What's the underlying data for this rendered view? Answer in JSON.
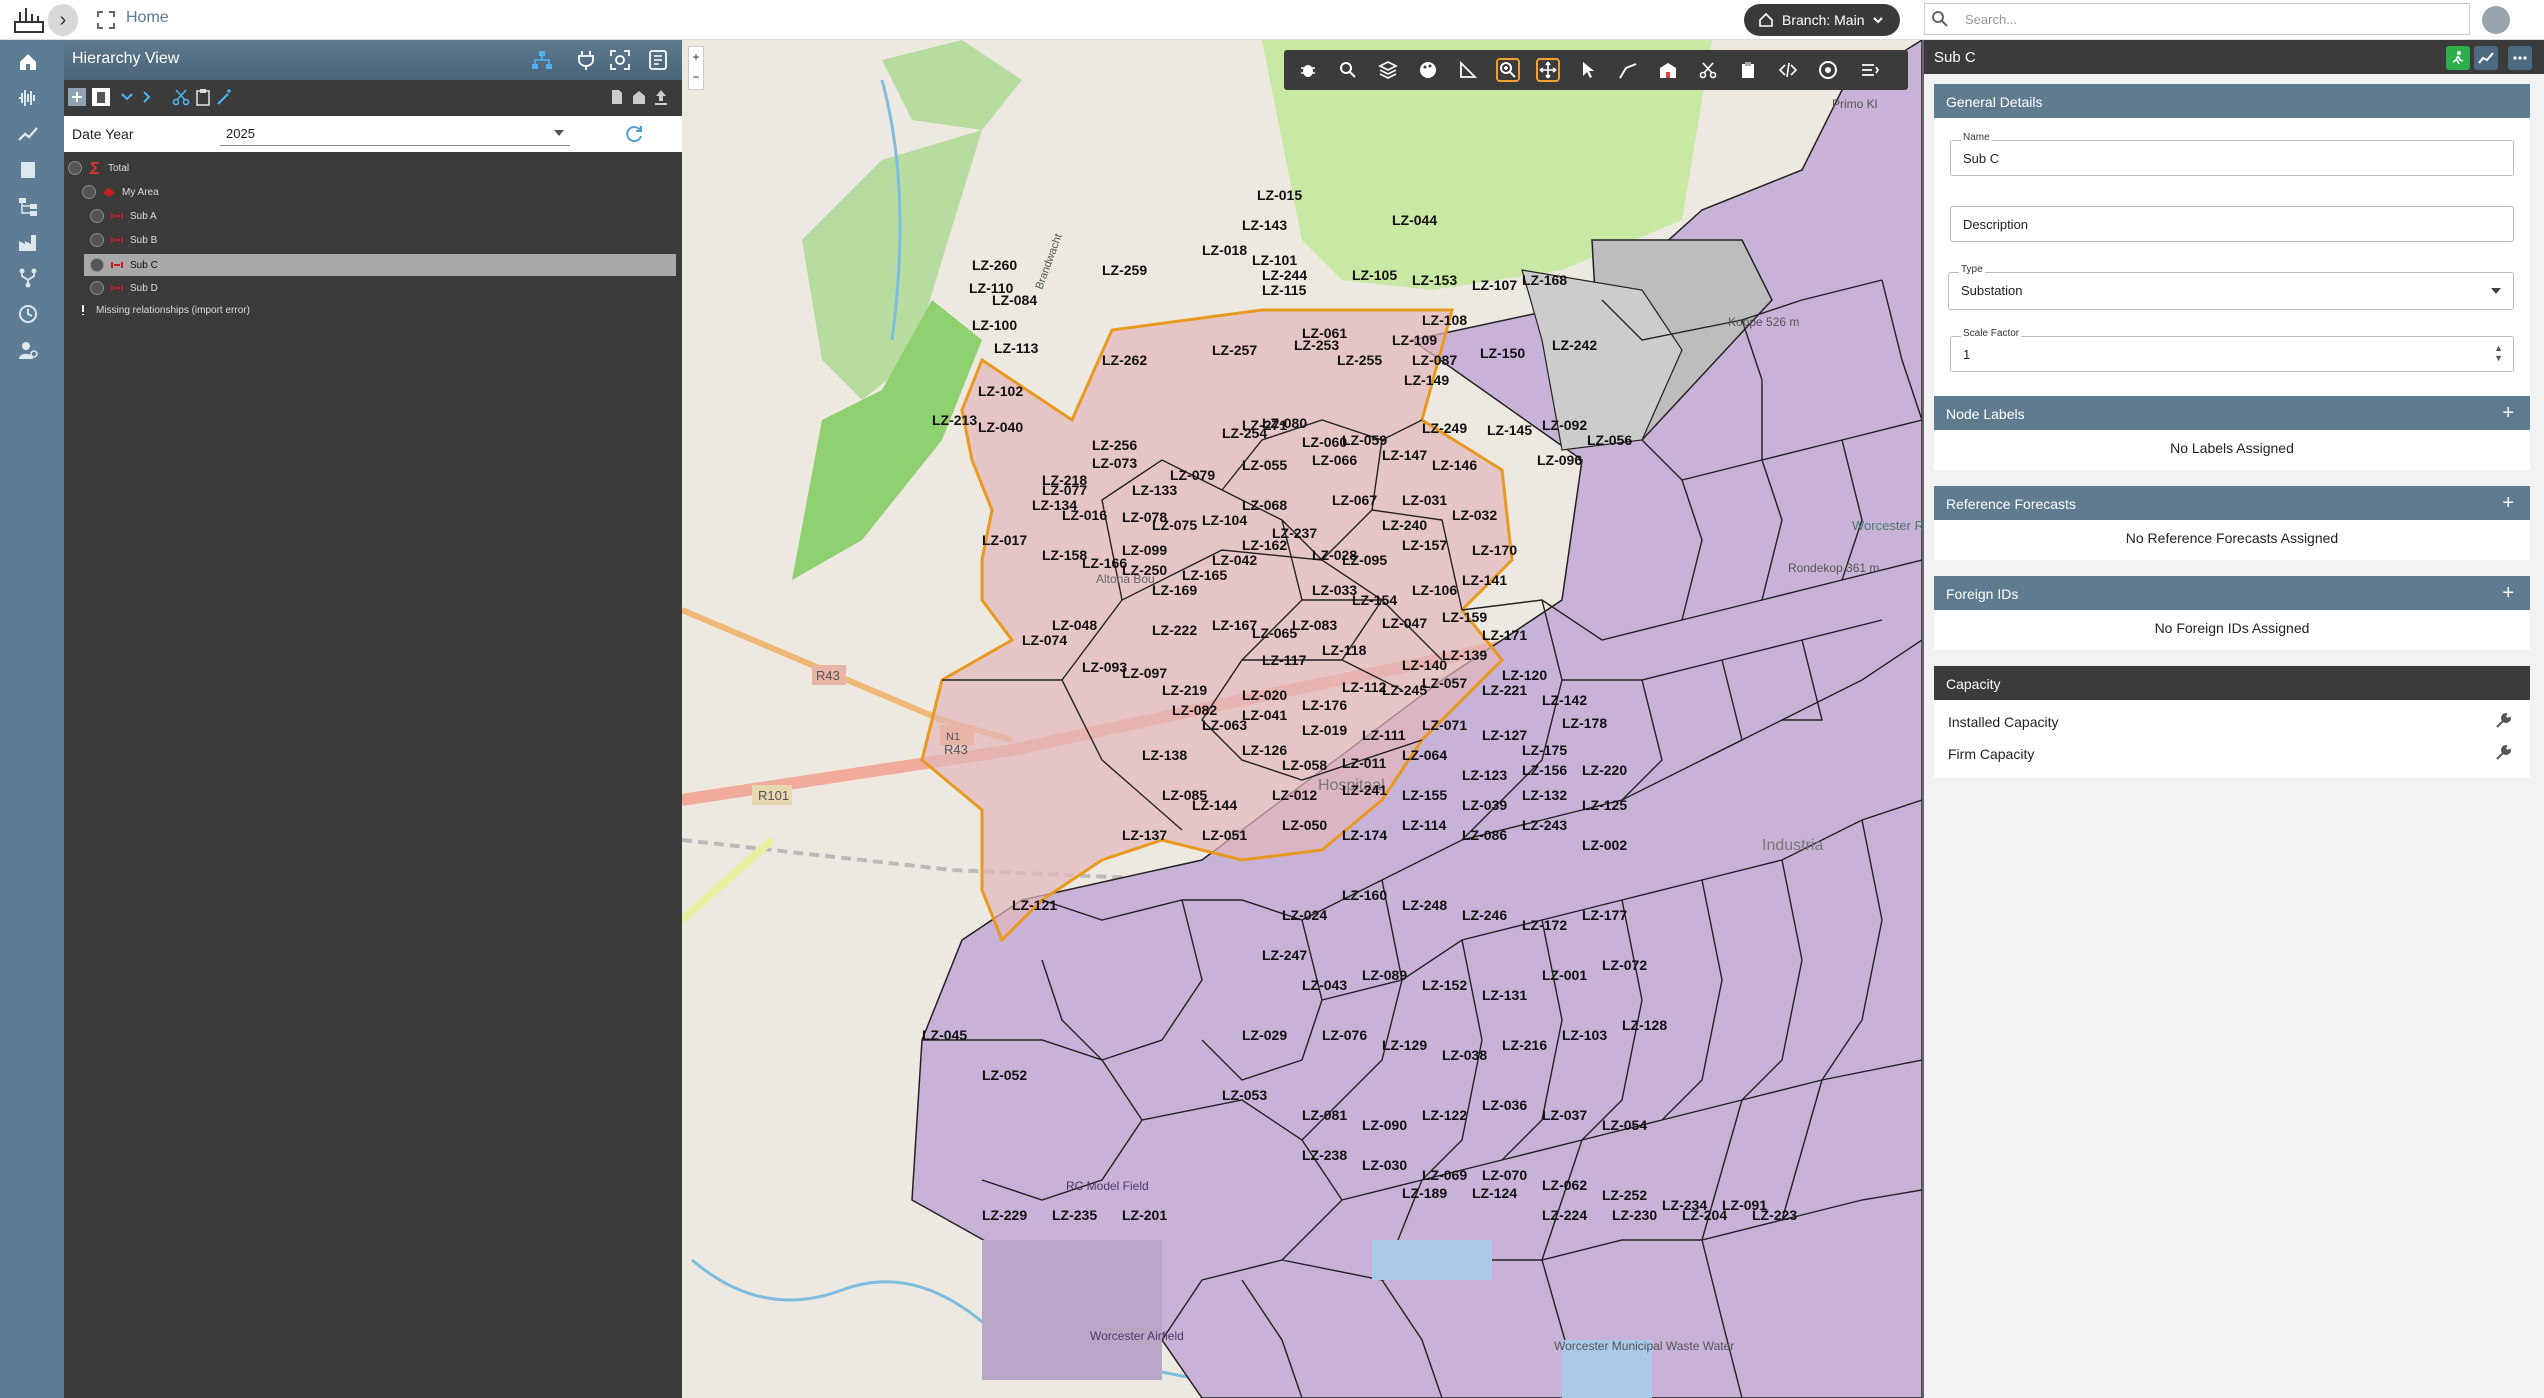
{
  "topbar": {
    "home": "Home",
    "branch": "Branch: Main",
    "search_placeholder": "Search..."
  },
  "nav": {
    "icons": [
      "home-icon",
      "waveform-icon",
      "trend-icon",
      "book-icon",
      "hierarchy-icon",
      "factory-icon",
      "branch-icon",
      "history-icon",
      "user-settings-icon"
    ]
  },
  "hierarchy": {
    "title": "Hierarchy View",
    "date_label": "Date Year",
    "date_value": "2025",
    "tree": [
      {
        "label": "Total",
        "level": 0
      },
      {
        "label": "My Area",
        "level": 1
      },
      {
        "label": "Sub A",
        "level": 2
      },
      {
        "label": "Sub B",
        "level": 2
      },
      {
        "label": "Sub C",
        "level": 2,
        "selected": true
      },
      {
        "label": "Sub D",
        "level": 2
      },
      {
        "label": "Missing relationships (import error)",
        "level": 0
      }
    ]
  },
  "map": {
    "road_labels": [
      "R43",
      "R43",
      "R101",
      "N1"
    ],
    "place_labels": [
      "Altona Bou",
      "Rondekop 361 m",
      "Worcester Reserv",
      "Koppe 526 m",
      "Brandwacht",
      "Primo Kl",
      "RC Model Field",
      "Worcester Airfield",
      "Worcester Municipal Waste Water",
      "Industria",
      "Hospitaal"
    ],
    "zones": [
      "LZ-015",
      "LZ-044",
      "LZ-018",
      "LZ-143",
      "LZ-101",
      "LZ-244",
      "LZ-115",
      "LZ-105",
      "LZ-153",
      "LZ-107",
      "LZ-168",
      "LZ-259",
      "LZ-260",
      "LZ-110",
      "LZ-084",
      "LZ-100",
      "LZ-113",
      "LZ-262",
      "LZ-257",
      "LZ-253",
      "LZ-255",
      "LZ-061",
      "LZ-109",
      "LZ-108",
      "LZ-087",
      "LZ-149",
      "LZ-150",
      "LZ-242",
      "LZ-102",
      "LZ-213",
      "LZ-040",
      "LZ-254",
      "LZ-256",
      "LZ-271",
      "LZ-080",
      "LZ-060",
      "LZ-059",
      "LZ-249",
      "LZ-145",
      "LZ-092",
      "LZ-056",
      "LZ-096",
      "LZ-218",
      "LZ-073",
      "LZ-079",
      "LZ-077",
      "LZ-134",
      "LZ-133",
      "LZ-055",
      "LZ-066",
      "LZ-147",
      "LZ-146",
      "LZ-016",
      "LZ-078",
      "LZ-075",
      "LZ-068",
      "LZ-067",
      "LZ-031",
      "LZ-017",
      "LZ-099",
      "LZ-104",
      "LZ-237",
      "LZ-162",
      "LZ-240",
      "LZ-032",
      "LZ-158",
      "LZ-166",
      "LZ-250",
      "LZ-042",
      "LZ-028",
      "LZ-095",
      "LZ-157",
      "LZ-170",
      "LZ-169",
      "LZ-165",
      "LZ-033",
      "LZ-154",
      "LZ-106",
      "LZ-141",
      "LZ-074",
      "LZ-048",
      "LZ-222",
      "LZ-167",
      "LZ-065",
      "LZ-083",
      "LZ-047",
      "LZ-159",
      "LZ-171",
      "LZ-093",
      "LZ-097",
      "LZ-117",
      "LZ-118",
      "LZ-140",
      "LZ-139",
      "LZ-120",
      "LZ-219",
      "LZ-176",
      "LZ-020",
      "LZ-112",
      "LZ-245",
      "LZ-057",
      "LZ-221",
      "LZ-142",
      "LZ-082",
      "LZ-041",
      "LZ-063",
      "LZ-019",
      "LZ-111",
      "LZ-071",
      "LZ-127",
      "LZ-175",
      "LZ-178",
      "LZ-138",
      "LZ-126",
      "LZ-058",
      "LZ-011",
      "LZ-064",
      "LZ-123",
      "LZ-156",
      "LZ-220",
      "LZ-085",
      "LZ-144",
      "LZ-012",
      "LZ-241",
      "LZ-155",
      "LZ-039",
      "LZ-132",
      "LZ-125",
      "LZ-137",
      "LZ-051",
      "LZ-050",
      "LZ-174",
      "LZ-114",
      "LZ-086",
      "LZ-243",
      "LZ-002",
      "LZ-121",
      "LZ-024",
      "LZ-160",
      "LZ-248",
      "LZ-246",
      "LZ-172",
      "LZ-177",
      "LZ-045",
      "LZ-247",
      "LZ-043",
      "LZ-089",
      "LZ-152",
      "LZ-131",
      "LZ-001",
      "LZ-072",
      "LZ-052",
      "LZ-029",
      "LZ-076",
      "LZ-129",
      "LZ-038",
      "LZ-216",
      "LZ-103",
      "LZ-128",
      "LZ-053",
      "LZ-081",
      "LZ-090",
      "LZ-122",
      "LZ-036",
      "LZ-037",
      "LZ-054",
      "LZ-238",
      "LZ-030",
      "LZ-069",
      "LZ-070",
      "LZ-062",
      "LZ-252",
      "LZ-234",
      "LZ-091",
      "LZ-189",
      "LZ-124",
      "LZ-224",
      "LZ-230",
      "LZ-204",
      "LZ-223",
      "LZ-229",
      "LZ-235",
      "LZ-201"
    ]
  },
  "panel": {
    "title": "Sub C",
    "general": {
      "heading": "General Details",
      "name_label": "Name",
      "name_value": "Sub C",
      "description_placeholder": "Description",
      "type_label": "Type",
      "type_value": "Substation",
      "scale_label": "Scale Factor",
      "scale_value": "1"
    },
    "node_labels": {
      "heading": "Node Labels",
      "empty": "No Labels Assigned"
    },
    "ref_forecasts": {
      "heading": "Reference Forecasts",
      "empty": "No Reference Forecasts Assigned"
    },
    "foreign_ids": {
      "heading": "Foreign IDs",
      "empty": "No Foreign IDs Assigned"
    },
    "capacity": {
      "heading": "Capacity",
      "rows": [
        "Installed Capacity",
        "Firm Capacity"
      ]
    }
  }
}
